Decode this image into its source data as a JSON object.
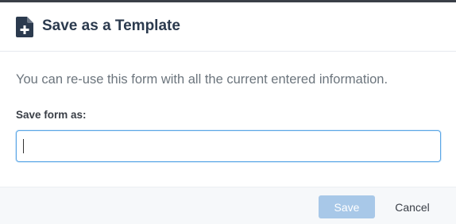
{
  "dialog": {
    "title": "Save as a Template",
    "title_icon": "document-add-icon",
    "description": "You can re-use this form with all the current entered information.",
    "field_label": "Save form as:",
    "field_value": "",
    "field_placeholder": ""
  },
  "footer": {
    "save_label": "Save",
    "cancel_label": "Cancel"
  },
  "colors": {
    "title": "#2b3a4e",
    "save_button_disabled": "#a8c8e8",
    "input_focus_border": "#5aa6e6",
    "footer_background": "#f6f8fa"
  }
}
